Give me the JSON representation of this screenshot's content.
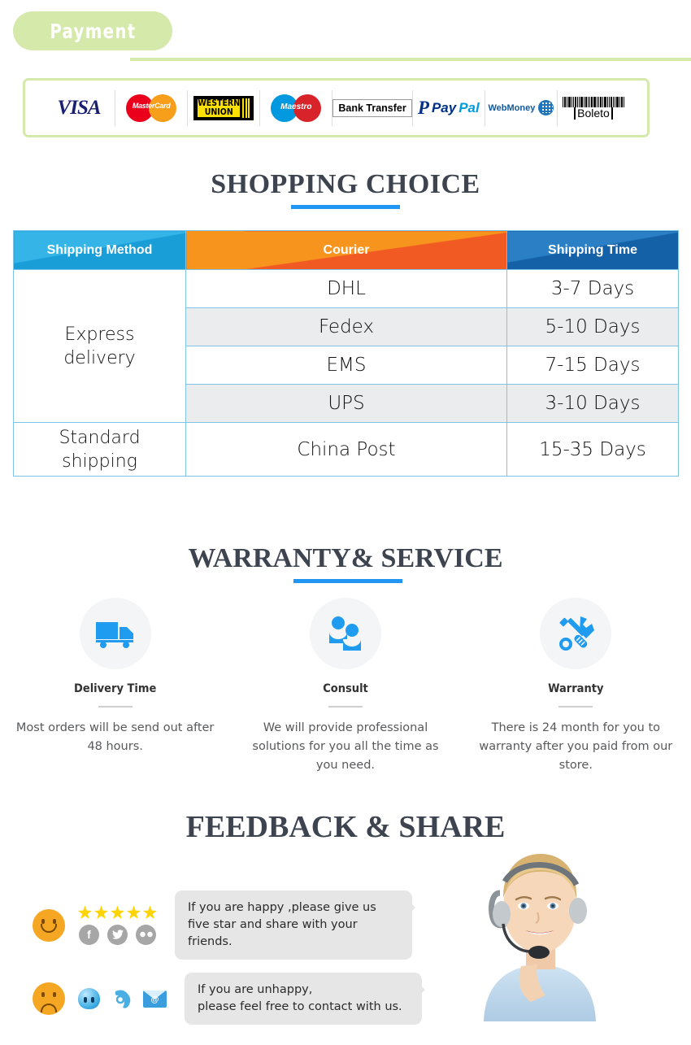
{
  "payment": {
    "badge_label": "Payment",
    "methods": [
      {
        "id": "visa",
        "label": "VISA"
      },
      {
        "id": "mastercard",
        "label": "MasterCard"
      },
      {
        "id": "western-union",
        "label_top": "WESTERN",
        "label_bottom": "UNION"
      },
      {
        "id": "maestro",
        "label": "Maestro"
      },
      {
        "id": "bank-transfer",
        "label": "Bank Transfer"
      },
      {
        "id": "paypal",
        "label_mark": "P",
        "label_pay": "Pay",
        "label_pal": "Pal"
      },
      {
        "id": "webmoney",
        "label": "WebMoney"
      },
      {
        "id": "boleto",
        "label": "Boleto"
      }
    ]
  },
  "shopping_choice": {
    "title": "SHOPPING CHOICE",
    "columns": [
      "Shipping Method",
      "Courier",
      "Shipping Time"
    ],
    "rows": [
      {
        "method": "Express delivery",
        "courier": "DHL",
        "time": "3-7  Days"
      },
      {
        "method": "",
        "courier": "Fedex",
        "time": "5-10 Days"
      },
      {
        "method": "",
        "courier": "EMS",
        "time": "7-15 Days"
      },
      {
        "method": "",
        "courier": "UPS",
        "time": "3-10 Days"
      },
      {
        "method": "Standard shipping",
        "courier": "China Post",
        "time": "15-35 Days"
      }
    ],
    "method_express_line1": "Express",
    "method_express_line2": "delivery",
    "method_standard_line1": "Standard",
    "method_standard_line2": "shipping",
    "accent_color": "#2196f3",
    "header_colors": {
      "left": "#35b4e8",
      "middle": "#f7941e",
      "right": "#2b7fc4"
    }
  },
  "warranty": {
    "title": "WARRANTY& SERVICE",
    "items": [
      {
        "icon": "truck-icon",
        "name": "Delivery Time",
        "desc": "Most orders will be send out after 48 hours."
      },
      {
        "icon": "people-icon",
        "name": "Consult",
        "desc": "We will provide professional solutions for you all the time as you need."
      },
      {
        "icon": "tools-icon",
        "name": "Warranty",
        "desc": "There is  24  month for you to warranty after you paid from our store."
      }
    ]
  },
  "feedback": {
    "title": "FEEDBACK & SHARE",
    "happy": {
      "face": "happy-face-icon",
      "star_count": 5,
      "socials": [
        "facebook-icon",
        "twitter-icon",
        "flickr-icon"
      ],
      "message_line1": "If you are happy ,please give us",
      "message_line2": "five star and share with your friends."
    },
    "unhappy": {
      "face": "sad-face-icon",
      "contacts": [
        "chat-icon",
        "phone-icon",
        "email-icon"
      ],
      "message_line1": "If you are unhappy,",
      "message_line2": "please feel free to contact with us."
    },
    "agent_image": "customer-service-agent-photo"
  }
}
